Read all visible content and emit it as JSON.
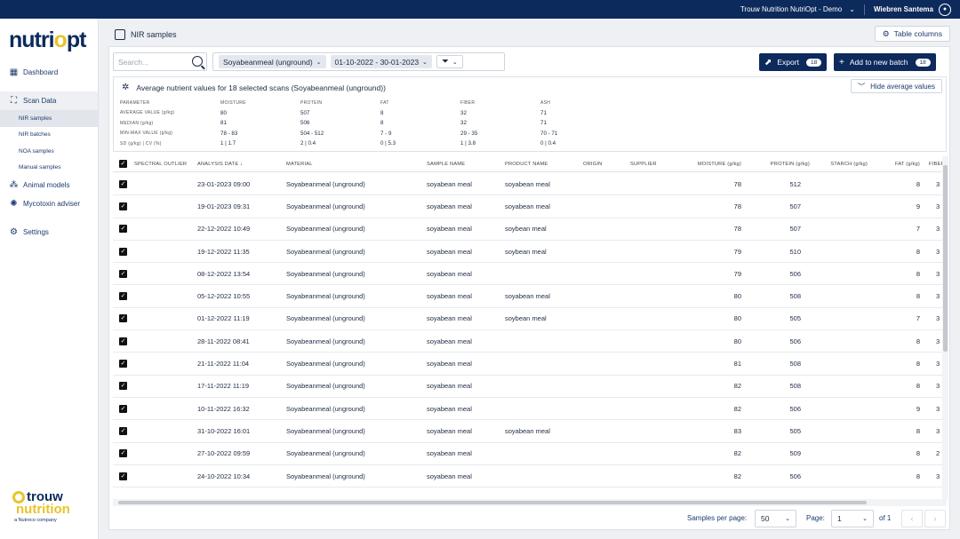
{
  "topbar": {
    "org": "Trouw Nutrition NutriOpt - Demo",
    "user": "Wiebren Santema"
  },
  "logo": {
    "text_a": "nutri",
    "text_o": "o",
    "text_b": "pt"
  },
  "sidebar": {
    "dashboard": "Dashboard",
    "scan_data": "Scan Data",
    "sub_items": [
      "NIR samples",
      "NIR batches",
      "NOA samples",
      "Manual samples"
    ],
    "animal_models": "Animal models",
    "mycotoxin": "Mycotoxin adviser",
    "settings": "Settings"
  },
  "brand": {
    "line1": "trouw",
    "line2": "nutrition",
    "line3": "a Nutreco company"
  },
  "page": {
    "title": "NIR samples",
    "table_columns_label": "Table columns"
  },
  "toolbar": {
    "search_placeholder": "Search...",
    "material_filter": "Soyabeanmeal (unground)",
    "date_filter": "01-10-2022 - 30-01-2023",
    "export_label": "Export",
    "export_count": "18",
    "add_batch_label": "Add to new batch",
    "add_batch_count": "18"
  },
  "averages": {
    "title": "Average nutrient values for 18 selected scans (Soyabeanmeal (unground))",
    "hide_label": "Hide average values",
    "header": [
      "PARAMETER",
      "MOISTURE",
      "PROTEIN",
      "FAT",
      "FIBER",
      "ASH"
    ],
    "rows": [
      [
        "AVERAGE VALUE (g/kg)",
        "80",
        "507",
        "8",
        "32",
        "71"
      ],
      [
        "MEDIAN (g/kg)",
        "81",
        "506",
        "8",
        "32",
        "71"
      ],
      [
        "MIN-MAX VALUE (g/kg)",
        "78 - 83",
        "504 - 512",
        "7 - 9",
        "29 - 35",
        "70 - 71"
      ],
      [
        "SD (g/kg) | CV (%)",
        "1 | 1.7",
        "2 | 0.4",
        "0 | 5.3",
        "1 | 3.8",
        "0 | 0.4"
      ]
    ]
  },
  "table": {
    "columns": [
      "SPECTRAL OUTLIER",
      "ANALYSIS DATE",
      "MATERIAL",
      "SAMPLE NAME",
      "PRODUCT NAME",
      "ORIGIN",
      "SUPPLIER",
      "MOISTURE (g/kg)",
      "PROTEIN (g/kg)",
      "STARCH (g/kg)",
      "FAT (g/kg)",
      "FIBER"
    ],
    "sort_icon": "arrow-down-icon",
    "rows": [
      {
        "date": "23-01-2023 09:00",
        "material": "Soyabeanmeal (unground)",
        "sample": "soyabean meal",
        "product": "soyabean meal",
        "moisture": "78",
        "protein": "512",
        "fat": "8",
        "fiber": "3"
      },
      {
        "date": "19-01-2023 09:31",
        "material": "Soyabeanmeal (unground)",
        "sample": "soyabean meal",
        "product": "soyabean meal",
        "moisture": "78",
        "protein": "507",
        "fat": "9",
        "fiber": "3"
      },
      {
        "date": "22-12-2022 10:49",
        "material": "Soyabeanmeal (unground)",
        "sample": "soyabean meal",
        "product": "soybean meal",
        "moisture": "78",
        "protein": "507",
        "fat": "7",
        "fiber": "3"
      },
      {
        "date": "19-12-2022 11:35",
        "material": "Soyabeanmeal (unground)",
        "sample": "soyabean meal",
        "product": "soybean meal",
        "moisture": "79",
        "protein": "510",
        "fat": "8",
        "fiber": "3"
      },
      {
        "date": "08-12-2022 13:54",
        "material": "Soyabeanmeal (unground)",
        "sample": "soyabean meal",
        "product": "",
        "moisture": "79",
        "protein": "506",
        "fat": "8",
        "fiber": "3"
      },
      {
        "date": "05-12-2022 10:55",
        "material": "Soyabeanmeal (unground)",
        "sample": "soyabean meal",
        "product": "soyabean meal",
        "moisture": "80",
        "protein": "508",
        "fat": "8",
        "fiber": "3"
      },
      {
        "date": "01-12-2022 11:19",
        "material": "Soyabeanmeal (unground)",
        "sample": "soyabean meal",
        "product": "soybean meal",
        "moisture": "80",
        "protein": "505",
        "fat": "7",
        "fiber": "3"
      },
      {
        "date": "28-11-2022 08:41",
        "material": "Soyabeanmeal (unground)",
        "sample": "soyabean meal",
        "product": "",
        "moisture": "80",
        "protein": "506",
        "fat": "8",
        "fiber": "3"
      },
      {
        "date": "21-11-2022 11:04",
        "material": "Soyabeanmeal (unground)",
        "sample": "soyabean meal",
        "product": "",
        "moisture": "81",
        "protein": "508",
        "fat": "8",
        "fiber": "3"
      },
      {
        "date": "17-11-2022 11:19",
        "material": "Soyabeanmeal (unground)",
        "sample": "soyabean meal",
        "product": "",
        "moisture": "82",
        "protein": "508",
        "fat": "8",
        "fiber": "3"
      },
      {
        "date": "10-11-2022 16:32",
        "material": "Soyabeanmeal (unground)",
        "sample": "soyabean meal",
        "product": "",
        "moisture": "82",
        "protein": "506",
        "fat": "9",
        "fiber": "3"
      },
      {
        "date": "31-10-2022 16:01",
        "material": "Soyabeanmeal (unground)",
        "sample": "soyabean meal",
        "product": "soyabean meal",
        "moisture": "83",
        "protein": "505",
        "fat": "8",
        "fiber": "3"
      },
      {
        "date": "27-10-2022 09:59",
        "material": "Soyabeanmeal (unground)",
        "sample": "soyabean meal",
        "product": "",
        "moisture": "82",
        "protein": "509",
        "fat": "8",
        "fiber": "2"
      },
      {
        "date": "24-10-2022 10:34",
        "material": "Soyabeanmeal (unground)",
        "sample": "soyabean meal",
        "product": "",
        "moisture": "82",
        "protein": "506",
        "fat": "8",
        "fiber": "3"
      }
    ]
  },
  "footer": {
    "samples_per_page_label": "Samples per page:",
    "samples_per_page": "50",
    "page_label": "Page:",
    "page": "1",
    "of_label": "of 1"
  },
  "colors": {
    "navy": "#0d2a5c",
    "accent_yellow": "#e8c42a"
  }
}
